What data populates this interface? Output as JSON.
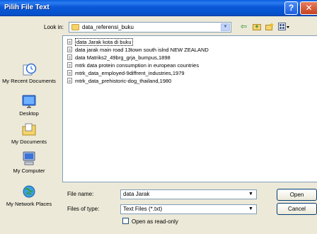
{
  "window": {
    "title": "Pilih File Text"
  },
  "look_in": {
    "label": "Look in:",
    "value": "data_referensi_buku"
  },
  "places": [
    {
      "label": "My Recent Documents",
      "icon": "recent-documents-icon"
    },
    {
      "label": "Desktop",
      "icon": "desktop-icon"
    },
    {
      "label": "My Documents",
      "icon": "my-documents-icon"
    },
    {
      "label": "My Computer",
      "icon": "my-computer-icon"
    },
    {
      "label": "My Network Places",
      "icon": "network-places-icon"
    }
  ],
  "files": [
    "data Jarak kota di buku",
    "data jarak main road 13town south islnd NEW ZEALAND",
    "data Matriks2_49brg_grja_bumpus,1898",
    "mtrk data protein consumption in european countries",
    "mtrk_data_employed-9diffrent_industries,1979",
    "mtrk_data_prehistoric-dog_thailand,1980"
  ],
  "form": {
    "file_name_label": "File name:",
    "file_name_value": "data Jarak",
    "file_type_label": "Files of type:",
    "file_type_value": "Text Files (*.txt)",
    "read_only_label": "Open as read-only",
    "open_label": "Open",
    "cancel_label": "Cancel"
  }
}
